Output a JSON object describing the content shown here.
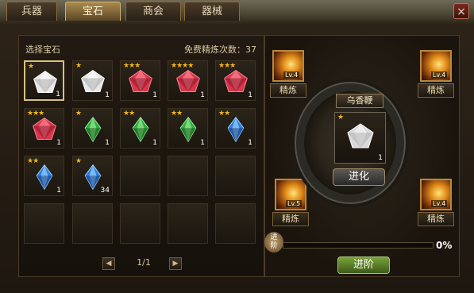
{
  "tabs": [
    {
      "label": "兵器"
    },
    {
      "label": "宝石"
    },
    {
      "label": "商会"
    },
    {
      "label": "器械"
    }
  ],
  "close_glyph": "×",
  "left_panel": {
    "title": "选择宝石",
    "free_refine_label": "免费精炼次数：37"
  },
  "gems": [
    {
      "color": "white",
      "stars": "★",
      "count": "1"
    },
    {
      "color": "white",
      "stars": "★",
      "count": "1"
    },
    {
      "color": "red",
      "stars": "★★★",
      "count": "1"
    },
    {
      "color": "red",
      "stars": "★★★★",
      "count": "1"
    },
    {
      "color": "red",
      "stars": "★★★",
      "count": "1"
    },
    {
      "color": "red",
      "stars": "★★★",
      "count": "1"
    },
    {
      "color": "green",
      "stars": "★",
      "count": "1"
    },
    {
      "color": "green",
      "stars": "★★",
      "count": "1"
    },
    {
      "color": "green",
      "stars": "★★",
      "count": "1"
    },
    {
      "color": "blue",
      "stars": "★★",
      "count": "1"
    },
    {
      "color": "blue",
      "stars": "★★",
      "count": "1"
    },
    {
      "color": "blue",
      "stars": "★",
      "count": "34"
    }
  ],
  "pager": {
    "prev": "◀",
    "next": "▶",
    "page": "1/1"
  },
  "skills": [
    {
      "level": "Lv.4",
      "refine_label": "精炼"
    },
    {
      "level": "Lv.4",
      "refine_label": "精炼"
    },
    {
      "level": "Lv.5",
      "refine_label": "精炼"
    },
    {
      "level": "Lv.4",
      "refine_label": "精炼"
    }
  ],
  "center": {
    "item_name": "乌香鞭",
    "gem_stars": "★",
    "gem_count": "1",
    "evolve_label": "进化"
  },
  "progress": {
    "tag": "进阶",
    "percent_label": "0%",
    "value_percent": 0
  },
  "advance_label": "进阶"
}
